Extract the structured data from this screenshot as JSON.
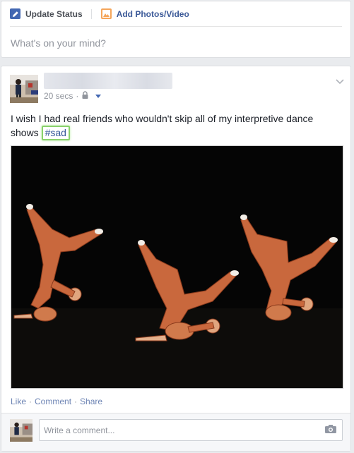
{
  "composer": {
    "tabs": [
      {
        "label": "Update Status",
        "icon": "pencil-icon"
      },
      {
        "label": "Add Photos/Video",
        "icon": "photo-icon"
      }
    ],
    "placeholder": "What's on your mind?"
  },
  "post": {
    "timestamp": "20 secs",
    "meta_separator": "·",
    "privacy_icon": "lock-icon",
    "text": "I wish I had real friends who wouldn't skip all of my interpretive dance shows",
    "hashtag": "#sad",
    "photo_alt": "Three dancers in orange costumes performing on a dark stage",
    "actions": [
      "Like",
      "Comment",
      "Share"
    ],
    "action_separator": "·",
    "comment_placeholder": "Write a comment..."
  },
  "colors": {
    "page_background": "#e9ebee",
    "link_blue": "#365899",
    "hashtag_highlight": "#8ad26d",
    "action_link": "#6d84b4"
  }
}
